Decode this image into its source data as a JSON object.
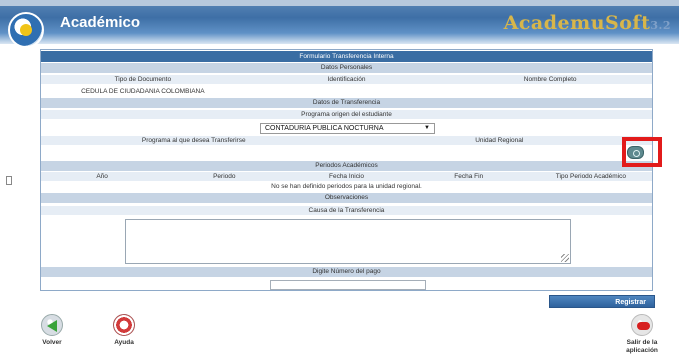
{
  "header": {
    "app_title": "Académico",
    "brand": "AcademuSoft",
    "brand_suffix": "3.2"
  },
  "form": {
    "title": "Formulario Transferencia Interna",
    "datos_personales": {
      "section_label": "Datos Personales",
      "columns": [
        "Tipo de Documento",
        "Identificación",
        "Nombre Completo"
      ],
      "values": [
        "CEDULA DE CIUDADANIA COLOMBIANA",
        "",
        ""
      ]
    },
    "datos_transferencia": {
      "section_label": "Datos de Transferencia",
      "programa_origen_label": "Programa origen del estudiante",
      "programa_origen_value": "CONTADURIA PUBLICA NOCTURNA",
      "programa_destino_label": "Programa al que desea Transferirse",
      "unidad_regional_label": "Unidad Regional"
    },
    "periodos": {
      "section_label": "Periodos Académicos",
      "columns": [
        "Año",
        "Periodo",
        "Fecha Inicio",
        "Fecha Fin",
        "Tipo Periodo Académico"
      ],
      "empty_message": "No se han definido periodos para la unidad regional."
    },
    "observaciones": {
      "section_label": "Observaciones",
      "causa_label": "Causa de la Transferencia",
      "causa_value": ""
    },
    "pago": {
      "label": "Digite Número del pago",
      "value": ""
    }
  },
  "actions": {
    "registrar": "Registrar",
    "volver": "Volver",
    "ayuda": "Ayuda",
    "salir": "Salir de la aplicación"
  },
  "colors": {
    "header_blue": "#3e6fa6",
    "section_dark": "#3a6da3",
    "section_light": "#c6d4e4",
    "highlight_red": "#e21b1b",
    "brand_gold": "#d8b64a"
  },
  "icons": {
    "logo": "academico-logo-icon",
    "search": "search-icon",
    "back": "back-arrow-icon",
    "help": "lifebuoy-icon",
    "exit": "exit-icon"
  }
}
